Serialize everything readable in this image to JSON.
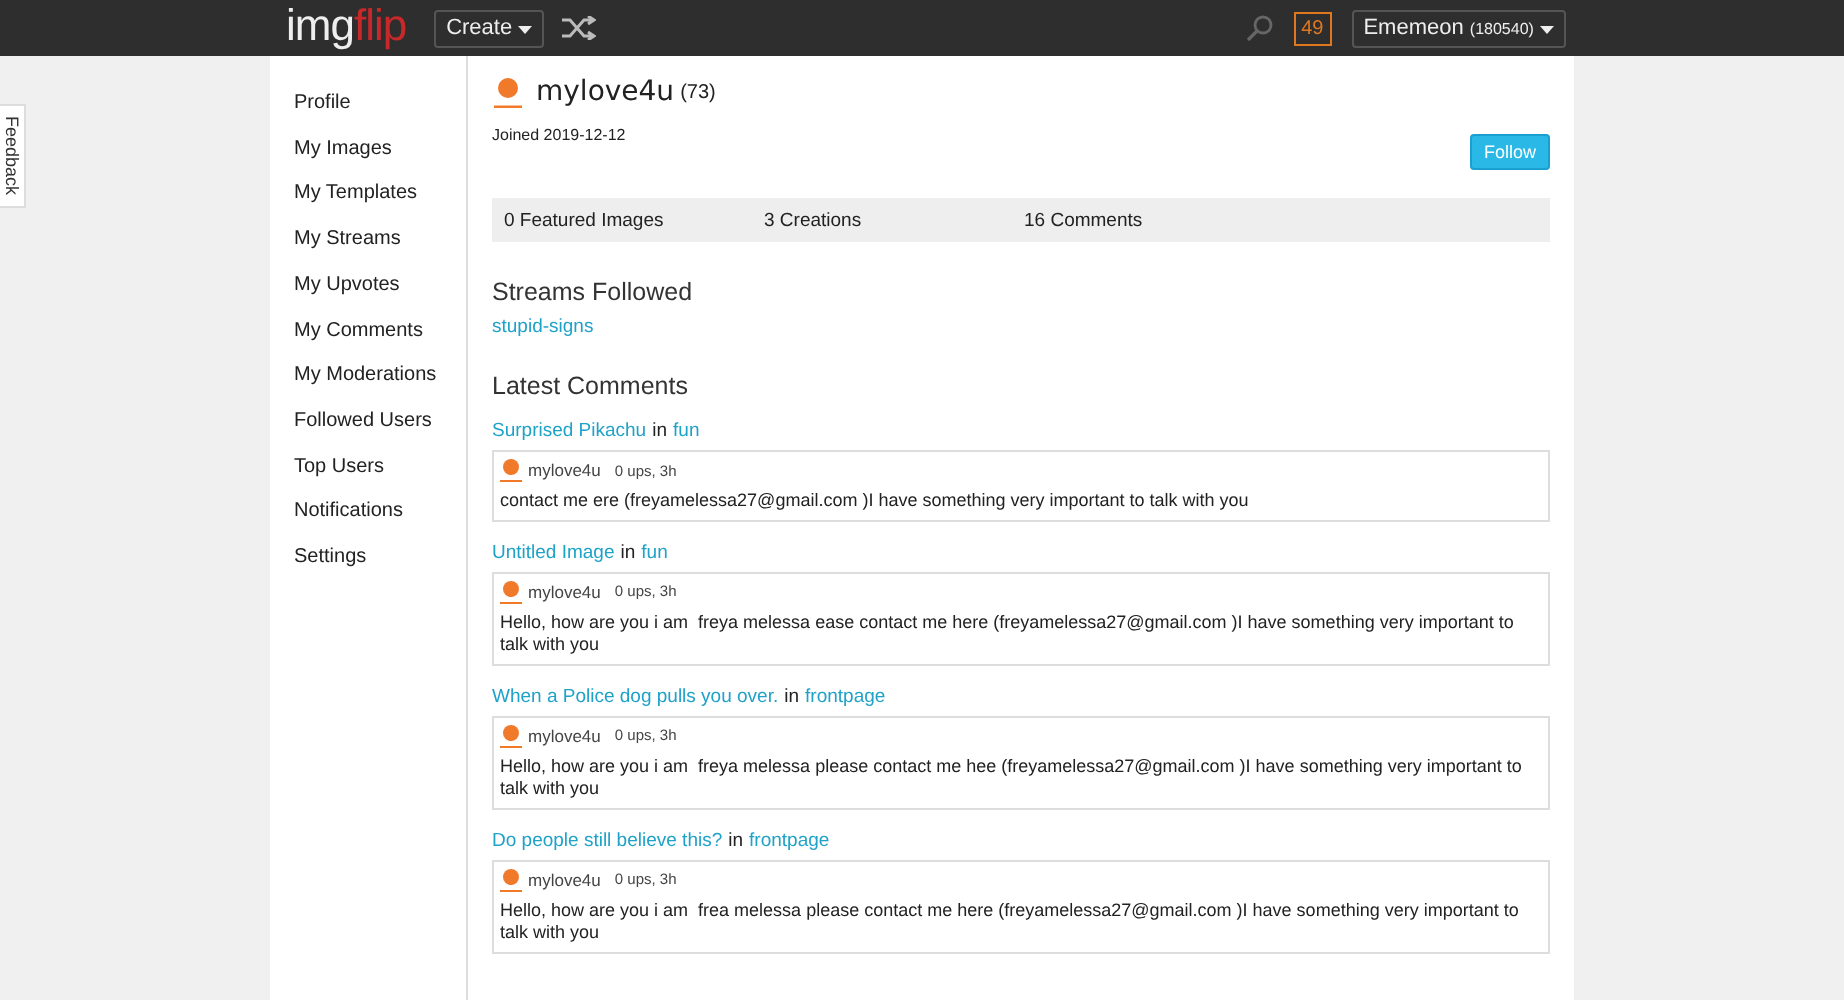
{
  "topbar": {
    "logo": [
      "img",
      "flip"
    ],
    "create_button": "Create",
    "notification_count": "49",
    "user_menu": {
      "name": "Ememeon",
      "points": "(180540)"
    }
  },
  "feedback_tab": "Feedback",
  "sidebar": {
    "items": [
      {
        "label": "Profile"
      },
      {
        "label": "My Images"
      },
      {
        "label": "My Templates"
      },
      {
        "label": "My Streams"
      },
      {
        "label": "My Upvotes"
      },
      {
        "label": "My Comments"
      },
      {
        "label": "My Moderations"
      },
      {
        "label": "Followed Users"
      },
      {
        "label": "Top Users"
      },
      {
        "label": "Notifications"
      },
      {
        "label": "Settings"
      }
    ]
  },
  "profile": {
    "username": "mylove4u",
    "points": "(73)",
    "joined": "Joined 2019-12-12",
    "follow_button": "Follow"
  },
  "stats": [
    "0 Featured Images",
    "3 Creations",
    "16 Comments"
  ],
  "streams_followed": {
    "heading": "Streams Followed",
    "streams": [
      "stupid-signs"
    ]
  },
  "latest_comments": {
    "heading": "Latest Comments",
    "comments": [
      {
        "image_title": "Surprised Pikachu",
        "in": "in",
        "stream": "fun",
        "author": "mylove4u",
        "meta": "0 ups, 3h",
        "text": "contact me ere (freyamelessa27@gmail.com )I have something very important to talk with you"
      },
      {
        "image_title": "Untitled Image",
        "in": "in",
        "stream": "fun",
        "author": "mylove4u",
        "meta": "0 ups, 3h",
        "text": "Hello, how are you i am  freya melessa ease contact me here (freyamelessa27@gmail.com )I have something very important to talk with you"
      },
      {
        "image_title": "When a Police dog pulls you over.",
        "in": "in",
        "stream": "frontpage",
        "author": "mylove4u",
        "meta": "0 ups, 3h",
        "text": "Hello, how are you i am  freya melessa please contact me hee (freyamelessa27@gmail.com )I have something very important to talk with you"
      },
      {
        "image_title": "Do people still believe this?",
        "in": "in",
        "stream": "frontpage",
        "author": "mylove4u",
        "meta": "0 ups, 3h",
        "text": "Hello, how are you i am  frea melessa please contact me here (freyamelessa27@gmail.com )I have something very important to talk with you"
      }
    ]
  }
}
